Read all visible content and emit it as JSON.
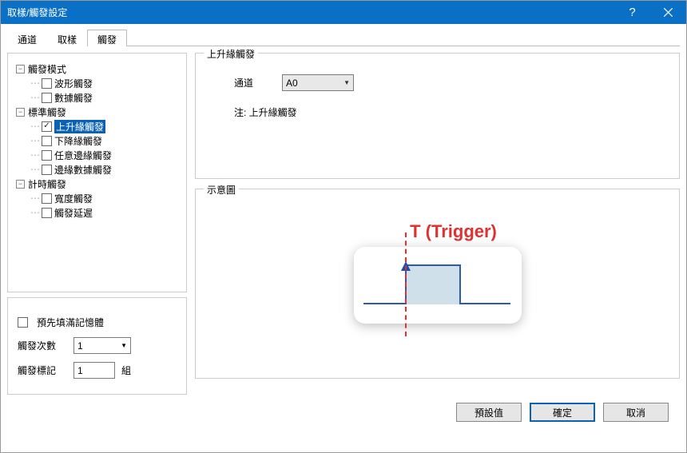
{
  "title": "取樣/觸發設定",
  "tabs": {
    "channel": "通道",
    "sample": "取樣",
    "trigger": "觸發"
  },
  "tree": {
    "mode": {
      "label": "觸發模式",
      "waveform": "波形觸發",
      "data": "數據觸發"
    },
    "standard": {
      "label": "標準觸發",
      "rising": "上升緣觸發",
      "falling": "下降緣觸發",
      "anyedge": "任意邊緣觸發",
      "edgedata": "邊緣數據觸發"
    },
    "timer": {
      "label": "計時觸發",
      "width": "寬度觸發",
      "delay": "觸發延遲"
    }
  },
  "config": {
    "legend": "上升緣觸發",
    "channel_label": "通道",
    "channel_value": "A0",
    "note_prefix": "注: ",
    "note_text": "上升緣觸發"
  },
  "diagram": {
    "legend": "示意圖",
    "trigger_text": "T (Trigger)"
  },
  "options": {
    "prefill": "預先填滿記憶體",
    "count_label": "觸發次數",
    "count_value": "1",
    "marker_label": "觸發標記",
    "marker_value": "1",
    "marker_unit": "組"
  },
  "buttons": {
    "defaults": "預設值",
    "ok": "確定",
    "cancel": "取消"
  }
}
